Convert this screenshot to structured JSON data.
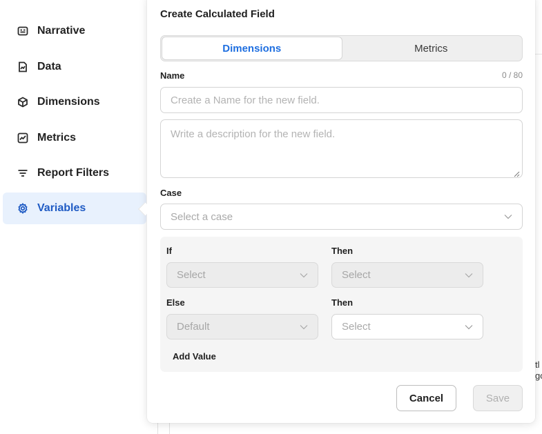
{
  "sidebar": {
    "items": [
      {
        "label": "Narrative",
        "icon": "narrative-icon"
      },
      {
        "label": "Data",
        "icon": "data-icon"
      },
      {
        "label": "Dimensions",
        "icon": "cube-icon"
      },
      {
        "label": "Metrics",
        "icon": "chart-icon"
      },
      {
        "label": "Report Filters",
        "icon": "filter-icon"
      },
      {
        "label": "Variables",
        "icon": "gear-icon",
        "active": true
      }
    ],
    "accent": "#1f5bc4",
    "active_bg": "#e8f1fd"
  },
  "background": {
    "snippet_1": "tl",
    "snippet_2": "gc"
  },
  "modal": {
    "title": "Create Calculated Field",
    "tabs": [
      {
        "label": "Dimensions",
        "active": true
      },
      {
        "label": "Metrics",
        "active": false
      }
    ],
    "name_label": "Name",
    "name_counter": "0 / 80",
    "name_placeholder": "Create a Name for the new field.",
    "description_placeholder": "Write a description for the new field.",
    "case_label": "Case",
    "case_placeholder": "Select a case",
    "rows": [
      {
        "left_label": "If",
        "left_value": "Select",
        "left_disabled": true,
        "right_label": "Then",
        "right_value": "Select",
        "right_disabled": true
      },
      {
        "left_label": "Else",
        "left_value": "Default",
        "left_disabled": true,
        "right_label": "Then",
        "right_value": "Select",
        "right_disabled": false
      }
    ],
    "add_value_label": "Add Value",
    "cancel_label": "Cancel",
    "save_label": "Save"
  }
}
